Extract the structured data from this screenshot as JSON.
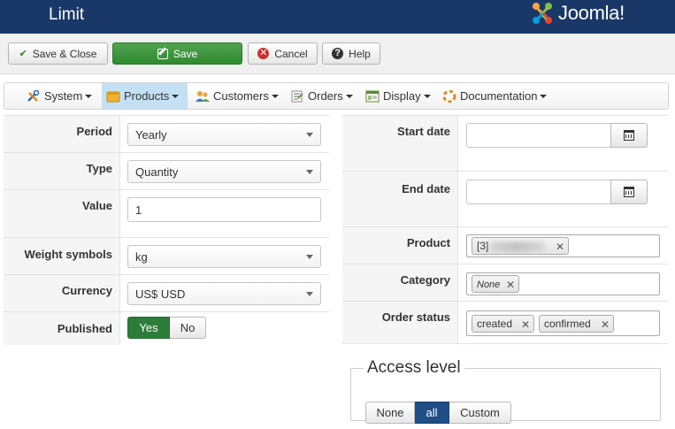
{
  "header": {
    "title": "Limit",
    "logo_text": "Joomla!",
    "logo_colors": [
      "#f9a541",
      "#7ac143",
      "#00a1e0",
      "#ee4035"
    ]
  },
  "toolbar": {
    "save_close_label": "Save & Close",
    "save_label": "Save",
    "cancel_label": "Cancel",
    "help_label": "Help"
  },
  "menu": {
    "items": [
      {
        "label": "System",
        "icon": "tools-icon"
      },
      {
        "label": "Products",
        "icon": "products-icon",
        "active": true
      },
      {
        "label": "Customers",
        "icon": "customers-icon"
      },
      {
        "label": "Orders",
        "icon": "orders-icon"
      },
      {
        "label": "Display",
        "icon": "display-icon"
      },
      {
        "label": "Documentation",
        "icon": "help-icon"
      }
    ]
  },
  "form_left": {
    "period": {
      "label": "Period",
      "value": "Yearly"
    },
    "type": {
      "label": "Type",
      "value": "Quantity"
    },
    "value": {
      "label": "Value",
      "value": "1"
    },
    "weight": {
      "label": "Weight symbols",
      "value": "kg"
    },
    "currency": {
      "label": "Currency",
      "value": "US$ USD"
    },
    "published": {
      "label": "Published",
      "yes": "Yes",
      "no": "No",
      "selected": "Yes"
    }
  },
  "form_right": {
    "start_date": {
      "label": "Start date",
      "value": ""
    },
    "end_date": {
      "label": "End date",
      "value": ""
    },
    "product": {
      "label": "Product",
      "tag_prefix": "[3]"
    },
    "category": {
      "label": "Category",
      "tag": "None"
    },
    "order_status": {
      "label": "Order status",
      "tags": [
        "created",
        "confirmed"
      ]
    }
  },
  "access_level": {
    "legend": "Access level",
    "options": [
      "None",
      "all",
      "Custom"
    ],
    "selected": "all"
  },
  "colors": {
    "header_bg": "#1a3867",
    "save_green": "#3b963b",
    "active_menu": "#c3e0f5",
    "yes_selected": "#2d7d3a",
    "all_selected": "#1f4d86"
  }
}
